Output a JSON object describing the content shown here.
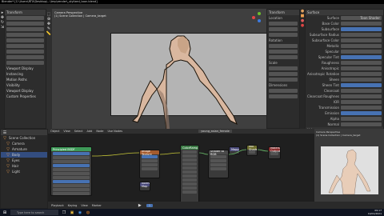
{
  "window_title": "Blender* [C:\\Users\\RTX\\Desktop\\...\\tmp\\render\\_stylized_toon.blend]",
  "viewport": {
    "header_left": "Camera Perspective",
    "header_sub": "(1) Scene Collection | Camera_target"
  },
  "left_panel": {
    "title": "Transform",
    "items": [
      "Viewport Display",
      "Instancing",
      "Motion Paths",
      "Visibility",
      "Viewport Display",
      "Custom Properties"
    ]
  },
  "n_panel": {
    "title": "Transform",
    "sections": [
      "Location",
      "Rotation",
      "Scale",
      "Dimensions"
    ]
  },
  "properties": {
    "title": "Surface",
    "surface_label": "Surface",
    "shader_value": "Toon Shader",
    "rows": [
      "Base Color",
      "Subsurface",
      "Subsurface Radius",
      "Subsurface Color",
      "Metallic",
      "Specular",
      "Specular Tint",
      "Roughness",
      "Anisotropic",
      "Anisotropic Rotation",
      "Sheen",
      "Sheen Tint",
      "Clearcoat",
      "Clearcoat Roughness",
      "IOR",
      "Transmission",
      "Emission",
      "Alpha",
      "Normal"
    ],
    "footer": "Volume",
    "footer2": "Settings",
    "footer3": "Viewport Display"
  },
  "node_editor": {
    "header_items": [
      "Object",
      "View",
      "Select",
      "Add",
      "Node",
      "Use Nodes"
    ],
    "material_name": "young_asian_female",
    "footer_label": "young_asian_female",
    "nodes": [
      "Principled BSDF",
      "Image Texture",
      "ColorRamp",
      "Mix Shader",
      "Material Output",
      "Shader to RGB",
      "Mapping",
      "Normal Map"
    ]
  },
  "outliner": {
    "items": [
      "Scene Collection",
      "Camera",
      "Armature",
      "Body",
      "Eyes",
      "Hair",
      "Light"
    ]
  },
  "render_preview": {
    "header": "Camera Perspective",
    "sub": "(1) Scene Collection | Camera_target"
  },
  "timeline": {
    "items": [
      "Playback",
      "Keying",
      "View",
      "Marker"
    ],
    "frame": "1"
  },
  "taskbar": {
    "search": "Type here to search",
    "time": "09:17",
    "date": "14/01/2021"
  },
  "colors": {
    "accent": "#4772b3",
    "skin": "#d9b79f",
    "bg_viewport": "#3f3f3f"
  }
}
